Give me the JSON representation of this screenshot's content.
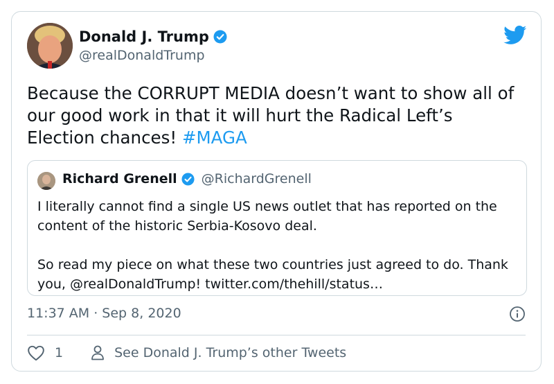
{
  "tweet": {
    "author_name": "Donald J. Trump",
    "author_handle": "@realDonaldTrump",
    "text": "Because the CORRUPT MEDIA doesn’t want to show all of our good work in that it will hurt the Radical Left’s Election chances! ",
    "hashtag": "#MAGA",
    "timestamp": "11:37 AM · Sep 8, 2020",
    "like_count": "1",
    "see_more_label": "See Donald J. Trump’s other Tweets"
  },
  "quoted": {
    "author_name": "Richard Grenell",
    "author_handle": "@RichardGrenell",
    "paragraph1": "I literally cannot find a single US news outlet that has reported on the content of the historic Serbia-Kosovo deal.",
    "paragraph2": "So read my piece on what these two countries just agreed to do. Thank you, @realDonaldTrump! twitter.com/thehill/status…"
  },
  "colors": {
    "accent": "#1d9bf0",
    "text": "#0f1419",
    "secondary": "#536471",
    "border": "#cfd9de"
  },
  "icons": [
    "verified-badge-icon",
    "twitter-bird-icon",
    "info-icon",
    "heart-icon",
    "person-icon"
  ]
}
